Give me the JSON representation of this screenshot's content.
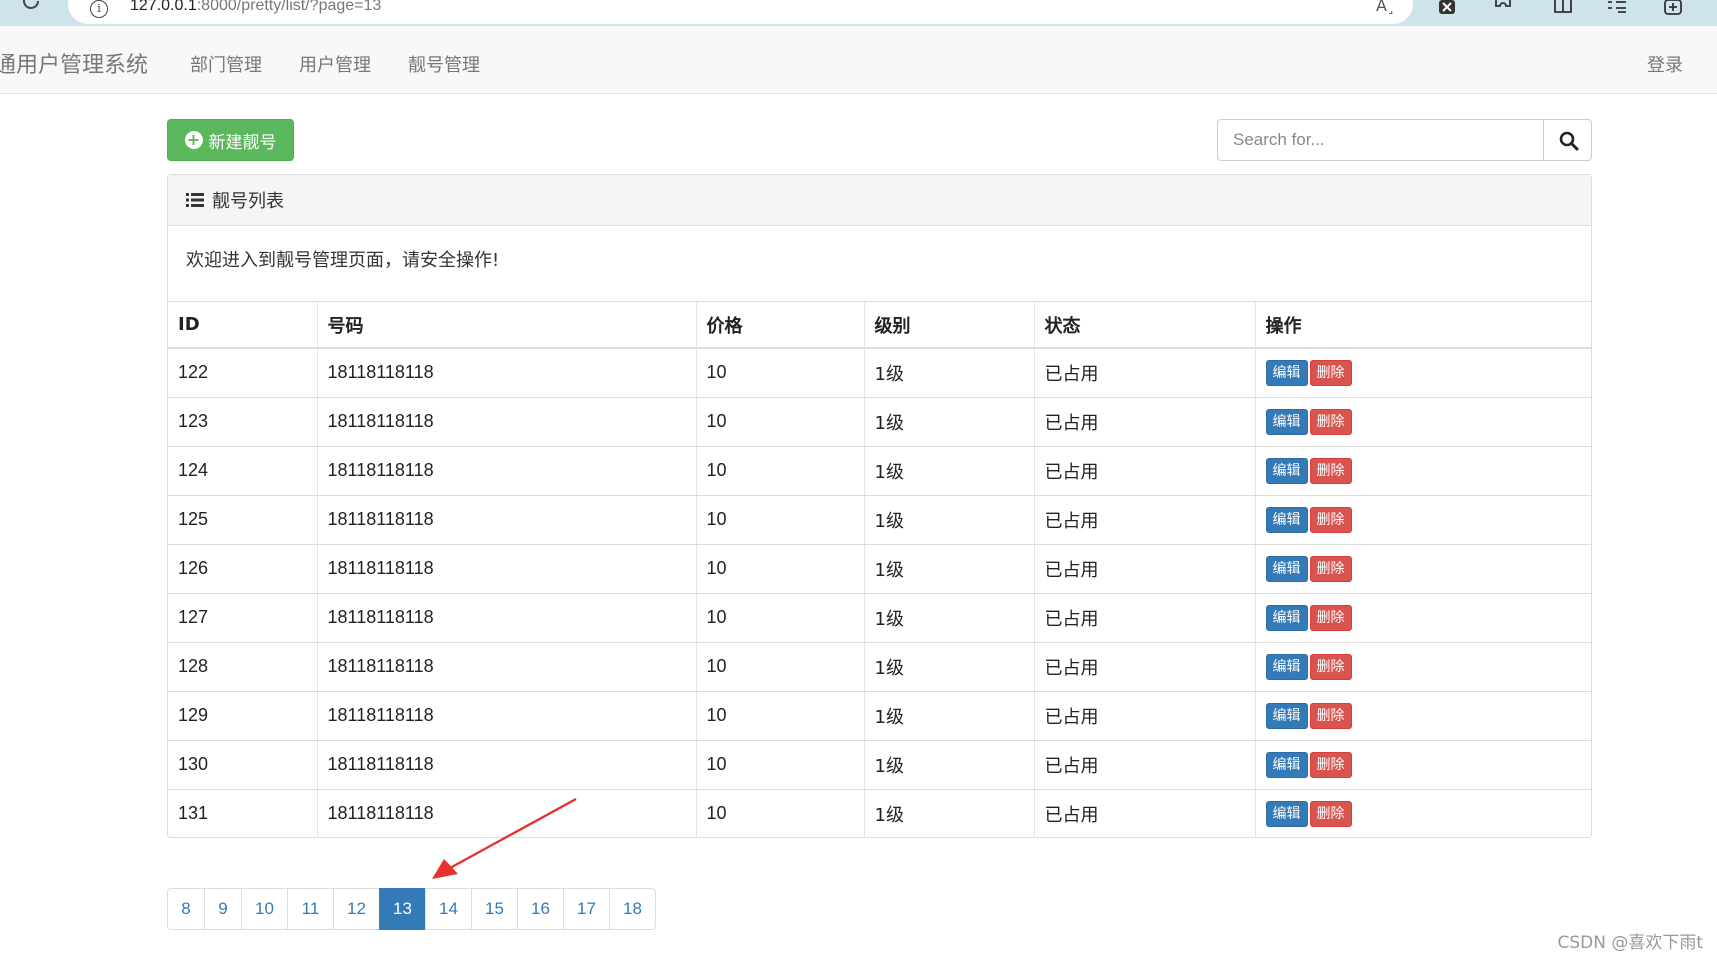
{
  "browser": {
    "url_host": "127.0.0.1",
    "url_path": ":8000/pretty/list/?page=13",
    "read_aloud_label": "A¸"
  },
  "navbar": {
    "brand": "通用户管理系统",
    "links": [
      "部门管理",
      "用户管理",
      "靓号管理"
    ],
    "login": "登录"
  },
  "actions": {
    "new_button": "新建靓号",
    "search_placeholder": "Search for..."
  },
  "panel": {
    "title": "靓号列表",
    "welcome": "欢迎进入到靓号管理页面，请安全操作!"
  },
  "table": {
    "headers": [
      "ID",
      "号码",
      "价格",
      "级别",
      "状态",
      "操作"
    ],
    "rows": [
      {
        "id": "122",
        "mobile": "18118118118",
        "price": "10",
        "level": "1级",
        "status": "已占用"
      },
      {
        "id": "123",
        "mobile": "18118118118",
        "price": "10",
        "level": "1级",
        "status": "已占用"
      },
      {
        "id": "124",
        "mobile": "18118118118",
        "price": "10",
        "level": "1级",
        "status": "已占用"
      },
      {
        "id": "125",
        "mobile": "18118118118",
        "price": "10",
        "level": "1级",
        "status": "已占用"
      },
      {
        "id": "126",
        "mobile": "18118118118",
        "price": "10",
        "level": "1级",
        "status": "已占用"
      },
      {
        "id": "127",
        "mobile": "18118118118",
        "price": "10",
        "level": "1级",
        "status": "已占用"
      },
      {
        "id": "128",
        "mobile": "18118118118",
        "price": "10",
        "level": "1级",
        "status": "已占用"
      },
      {
        "id": "129",
        "mobile": "18118118118",
        "price": "10",
        "level": "1级",
        "status": "已占用"
      },
      {
        "id": "130",
        "mobile": "18118118118",
        "price": "10",
        "level": "1级",
        "status": "已占用"
      },
      {
        "id": "131",
        "mobile": "18118118118",
        "price": "10",
        "level": "1级",
        "status": "已占用"
      }
    ],
    "edit_label": "编辑",
    "delete_label": "删除"
  },
  "pagination": {
    "pages": [
      "8",
      "9",
      "10",
      "11",
      "12",
      "13",
      "14",
      "15",
      "16",
      "17",
      "18"
    ],
    "current": "13"
  },
  "colors": {
    "success": "#5cb85c",
    "primary": "#337ab7",
    "danger": "#d9534f",
    "annotation_arrow": "#e8312f"
  },
  "watermark": "CSDN @喜欢下雨t"
}
